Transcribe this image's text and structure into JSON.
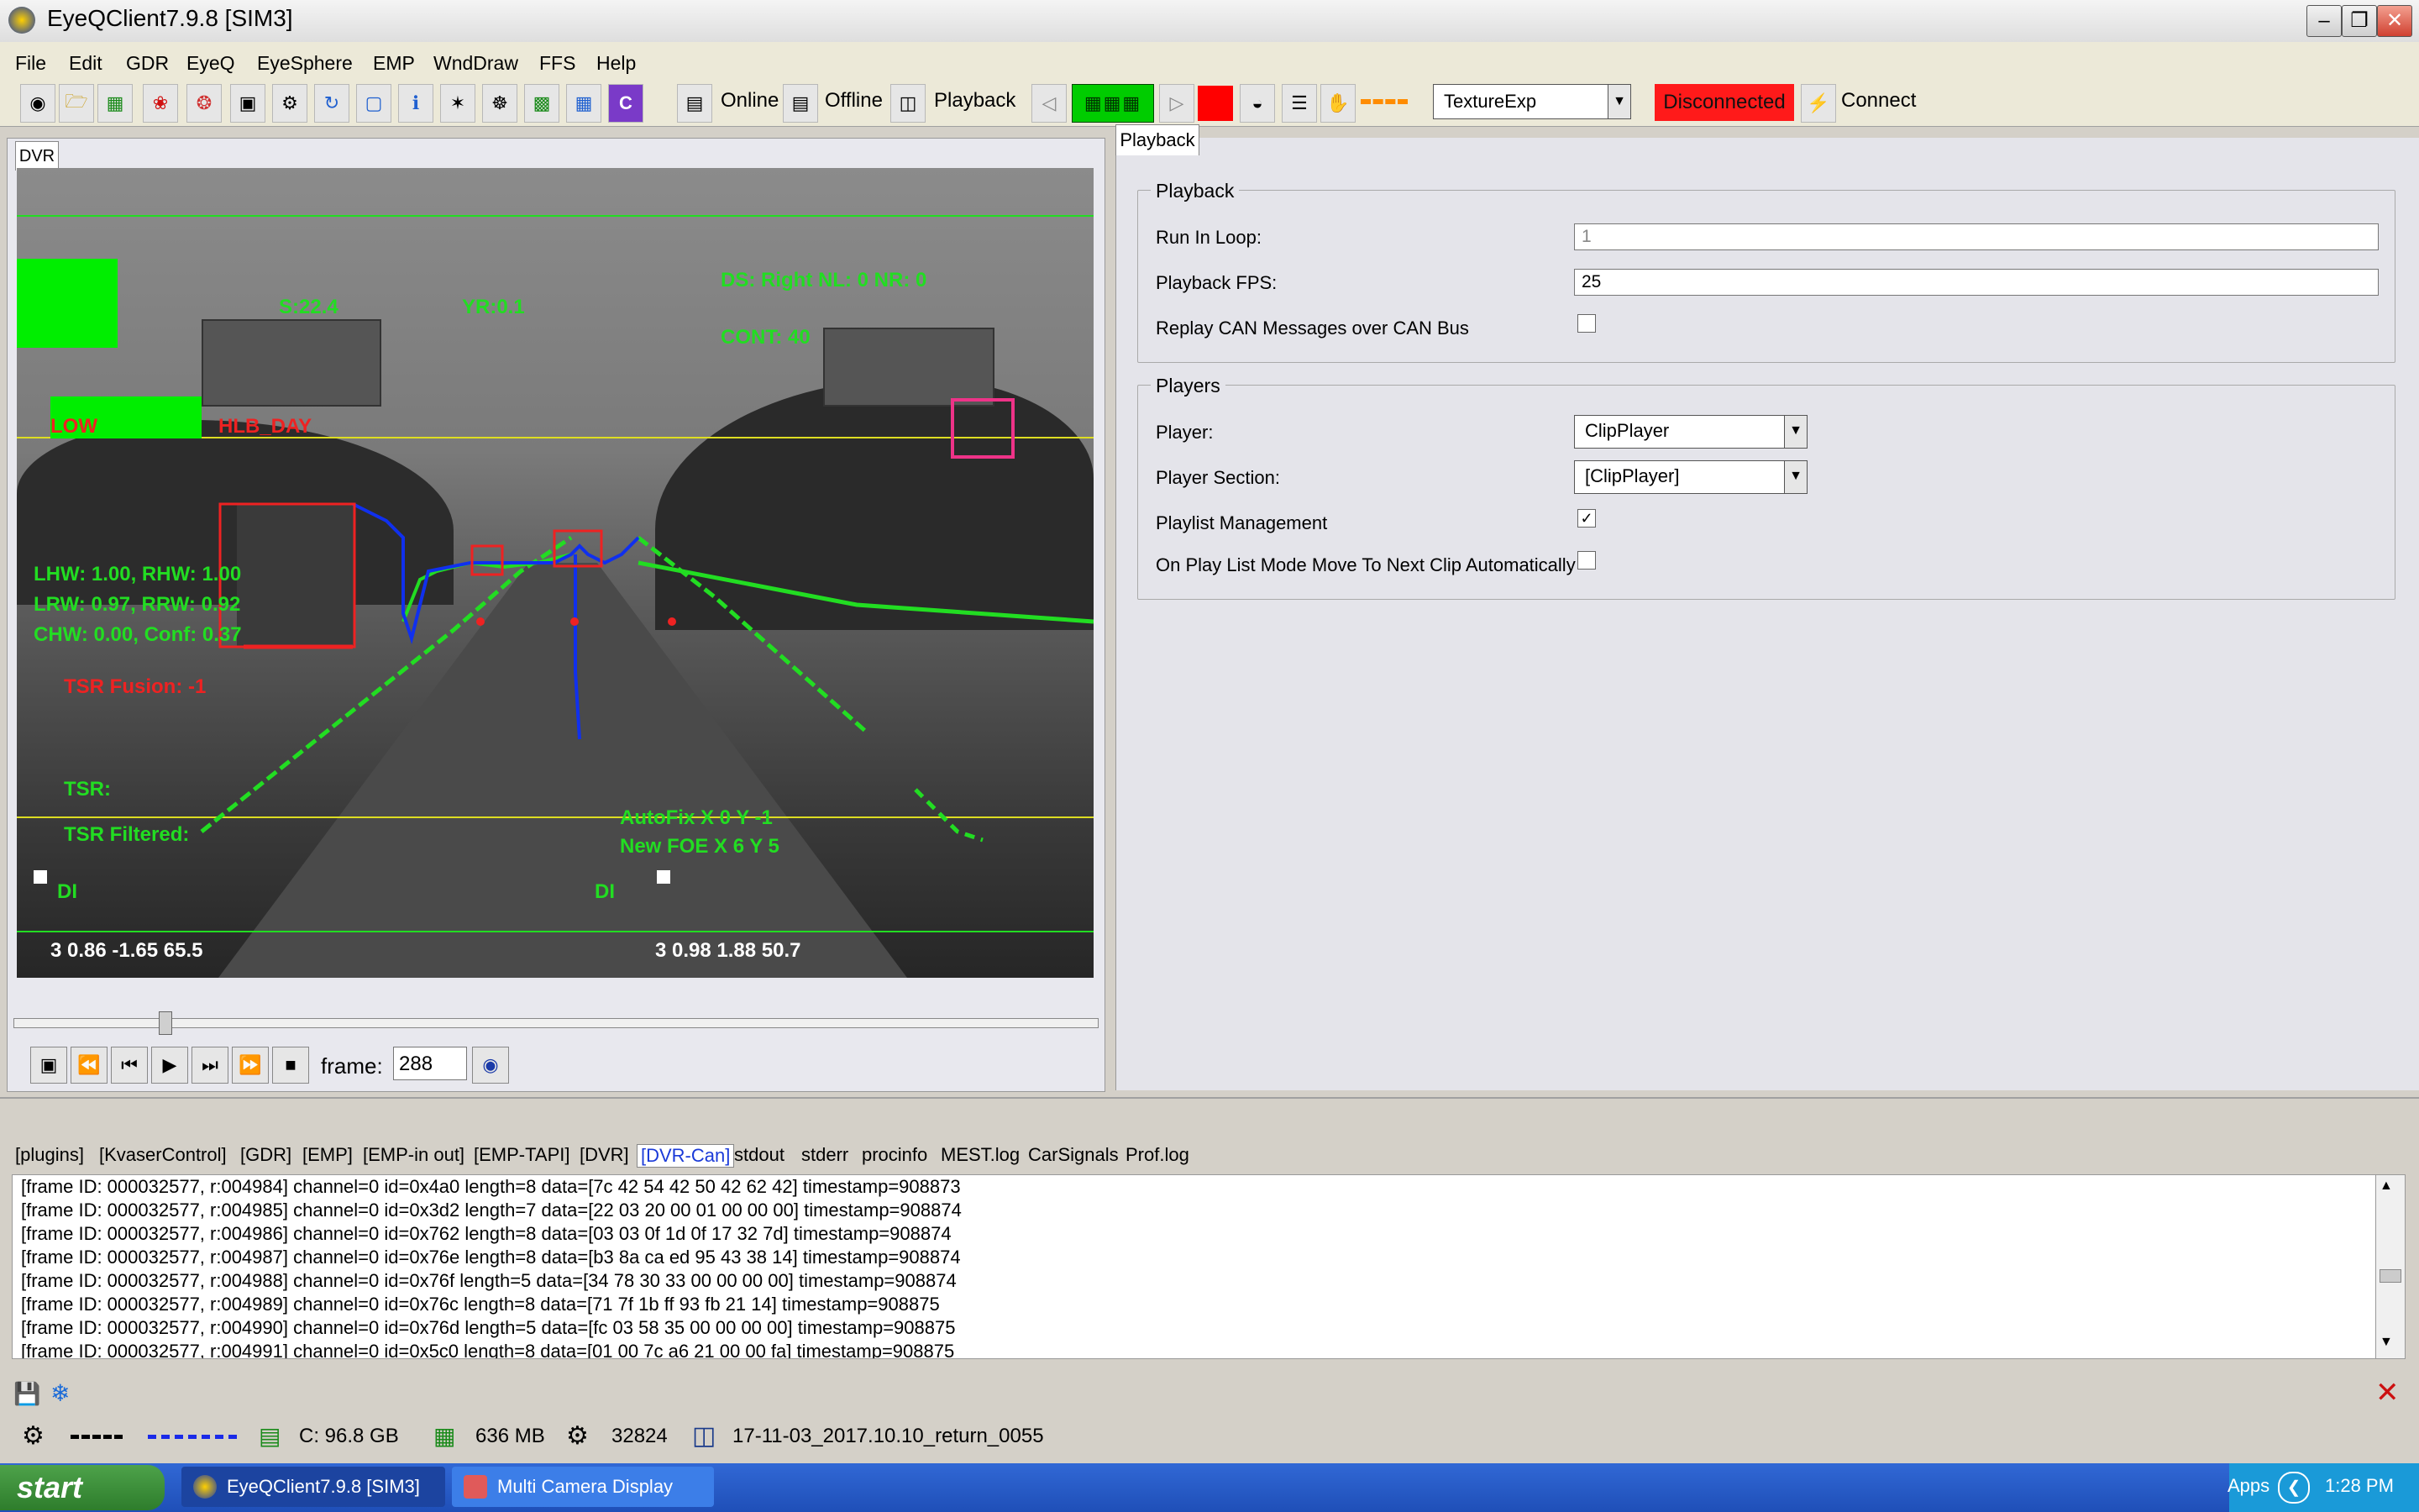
{
  "window": {
    "title": "EyeQClient7.9.8 [SIM3]"
  },
  "menu": [
    "File",
    "Edit",
    "GDR",
    "EyeQ",
    "EyeSphere",
    "EMP",
    "WndDraw",
    "FFS",
    "Help"
  ],
  "toolbar": {
    "online_label": "Online",
    "offline_label": "Offline",
    "playback_label": "Playback",
    "texture_select": "TextureExp",
    "status_label": "Disconnected",
    "connect_label": "Connect",
    "colors": {
      "disconnected_bg": "#ff1a1a",
      "led_green": "#00cc00",
      "stop_red": "#ff0000"
    }
  },
  "dvr": {
    "tab_label": "DVR",
    "overlay": {
      "speed": "S:22.4",
      "yaw_rate": "YR:0.1",
      "ds": "DS: Right  NL: 0  NR: 0",
      "cont": "CONT: 40",
      "low": "LOW",
      "hlb": "HLB_DAY",
      "lhw": "LHW: 1.00, RHW: 1.00",
      "lrw": "LRW: 0.97, RRW: 0.92",
      "chw": "CHW: 0.00, Conf: 0.37",
      "tsr_fusion": "TSR Fusion: -1",
      "tsr": "TSR:",
      "tsr_filtered": "TSR Filtered:",
      "autofix": "AutoFix X 0 Y -1",
      "new_foe": "New FOE X 6 Y 5",
      "di_left": "DI",
      "di_right": "DI",
      "bottom_left": "3 0.86 -1.65 65.5",
      "bottom_right": "3 0.98 1.88 50.7"
    },
    "slider_position": 0.14,
    "frame_label": "frame:",
    "frame_value": "288"
  },
  "playback_panel": {
    "tab_label": "Playback",
    "group_playback": "Playback",
    "run_in_loop_label": "Run In Loop:",
    "run_in_loop_value": "1",
    "fps_label": "Playback FPS:",
    "fps_value": "25",
    "replay_can_label": "Replay CAN Messages over CAN Bus",
    "replay_can_checked": false,
    "group_players": "Players",
    "player_label": "Player:",
    "player_value": "ClipPlayer",
    "player_section_label": "Player Section:",
    "player_section_value": "[ClipPlayer]",
    "playlist_mgmt_label": "Playlist Management",
    "playlist_mgmt_checked": true,
    "playlist_mode_label": "On Play List Mode Move To Next Clip Automatically",
    "playlist_mode_checked": false
  },
  "log": {
    "tabs": [
      "[plugins]",
      "[KvaserControl]",
      "[GDR]",
      "[EMP]",
      "[EMP-in out]",
      "[EMP-TAPI]",
      "[DVR]",
      "[DVR-Can]",
      "stdout",
      "stderr",
      "procinfo",
      "MEST.log",
      "CarSignals",
      "Prof.log"
    ],
    "active_tab": "[DVR-Can]",
    "lines": [
      "[frame ID: 000032577, r:004984] channel=0 id=0x4a0 length=8  data=[7c 42 54 42 50 42 62 42] timestamp=908873",
      "[frame ID: 000032577, r:004985] channel=0 id=0x3d2 length=7  data=[22 03 20 00 01 00 00 00] timestamp=908874",
      "[frame ID: 000032577, r:004986] channel=0 id=0x762 length=8  data=[03 03 0f 1d 0f 17 32 7d] timestamp=908874",
      "[frame ID: 000032577, r:004987] channel=0 id=0x76e length=8  data=[b3 8a ca ed 95 43 38 14] timestamp=908874",
      "[frame ID: 000032577, r:004988] channel=0 id=0x76f length=5  data=[34 78 30 33 00 00 00 00] timestamp=908874",
      "[frame ID: 000032577, r:004989] channel=0 id=0x76c length=8  data=[71 7f 1b ff 93 fb 21 14] timestamp=908875",
      "[frame ID: 000032577, r:004990] channel=0 id=0x76d length=5  data=[fc 03 58 35 00 00 00 00] timestamp=908875",
      "[frame ID: 000032577, r:004991] channel=0 id=0x5c0 length=8  data=[01 00 7c a6 21 00 00 fa] timestamp=908875"
    ]
  },
  "statusbar": {
    "disk": "C: 96.8 GB",
    "memory": "636 MB",
    "count": "32824",
    "clip": "17-11-03_2017.10.10_return_0055"
  },
  "taskbar": {
    "start": "start",
    "tasks": [
      "EyeQClient7.9.8 [SIM3]",
      "Multi Camera Display"
    ],
    "apps": "Apps",
    "clock": "1:28 PM"
  }
}
